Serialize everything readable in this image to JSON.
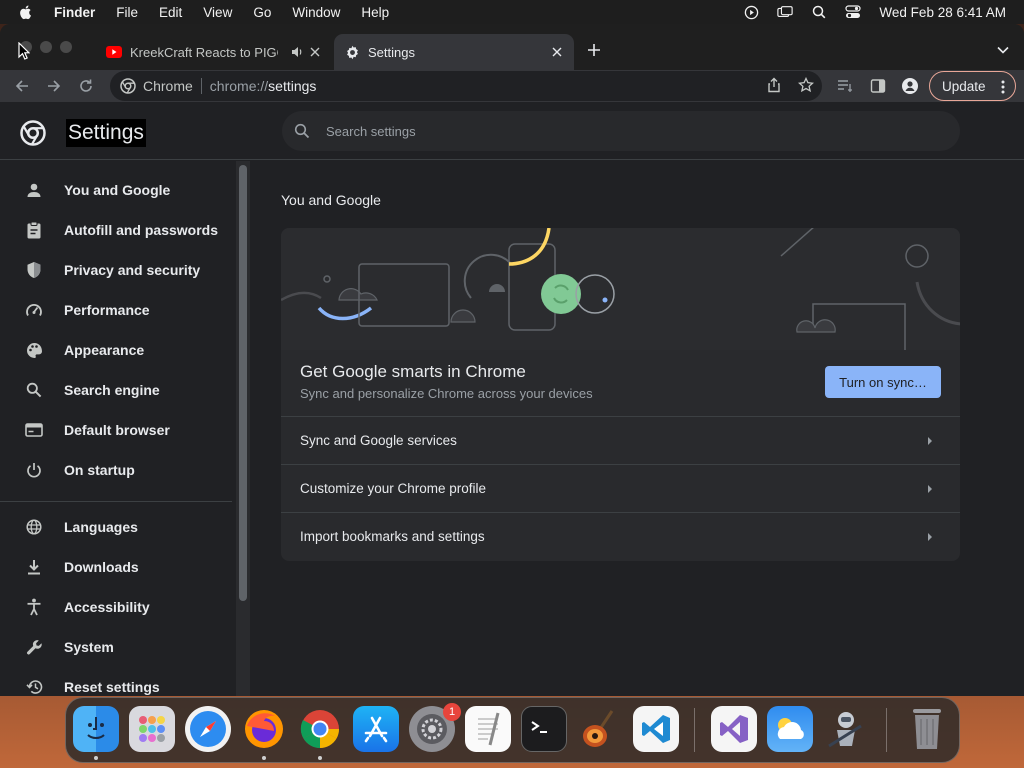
{
  "menubar": {
    "app_name": "Finder",
    "items": [
      "File",
      "Edit",
      "View",
      "Go",
      "Window",
      "Help"
    ],
    "clock": "Wed Feb 28  6:41 AM"
  },
  "tabs": [
    {
      "title": "KreekCraft Reacts to PIGGY",
      "active": false
    },
    {
      "title": "Settings",
      "active": true
    }
  ],
  "omnibox": {
    "site": "Chrome",
    "scheme": "chrome://",
    "path": "settings"
  },
  "toolbar": {
    "update_label": "Update"
  },
  "settings": {
    "title": "Settings",
    "search_placeholder": "Search settings"
  },
  "sidebar": {
    "items": [
      {
        "label": "You and Google",
        "icon": "person-icon"
      },
      {
        "label": "Autofill and passwords",
        "icon": "clipboard-icon"
      },
      {
        "label": "Privacy and security",
        "icon": "shield-icon"
      },
      {
        "label": "Performance",
        "icon": "speedometer-icon"
      },
      {
        "label": "Appearance",
        "icon": "palette-icon"
      },
      {
        "label": "Search engine",
        "icon": "search-icon"
      },
      {
        "label": "Default browser",
        "icon": "browser-icon"
      },
      {
        "label": "On startup",
        "icon": "power-icon"
      },
      {
        "label": "Languages",
        "icon": "globe-icon"
      },
      {
        "label": "Downloads",
        "icon": "download-icon"
      },
      {
        "label": "Accessibility",
        "icon": "accessibility-icon"
      },
      {
        "label": "System",
        "icon": "wrench-icon"
      },
      {
        "label": "Reset settings",
        "icon": "history-icon"
      }
    ]
  },
  "main": {
    "section_title": "You and Google",
    "promo_title": "Get Google smarts in Chrome",
    "promo_subtitle": "Sync and personalize Chrome across your devices",
    "sync_button": "Turn on sync…",
    "rows": [
      {
        "label": "Sync and Google services"
      },
      {
        "label": "Customize your Chrome profile"
      },
      {
        "label": "Import bookmarks and settings"
      }
    ]
  },
  "dock": {
    "apps": [
      "finder-icon",
      "launchpad-icon",
      "safari-icon",
      "firefox-icon",
      "chrome-icon",
      "app-store-icon",
      "system-settings-icon",
      "textedit-icon",
      "terminal-icon",
      "garageband-icon",
      "vscode-icon",
      "visual-studio-icon",
      "weather-icon",
      "automator-icon",
      "trash-icon"
    ],
    "settings_badge": "1"
  },
  "colors": {
    "accent_blue": "#8ab4f8",
    "page_bg": "#202124",
    "card_bg": "#292a2d",
    "update_border": "#e8a798"
  }
}
